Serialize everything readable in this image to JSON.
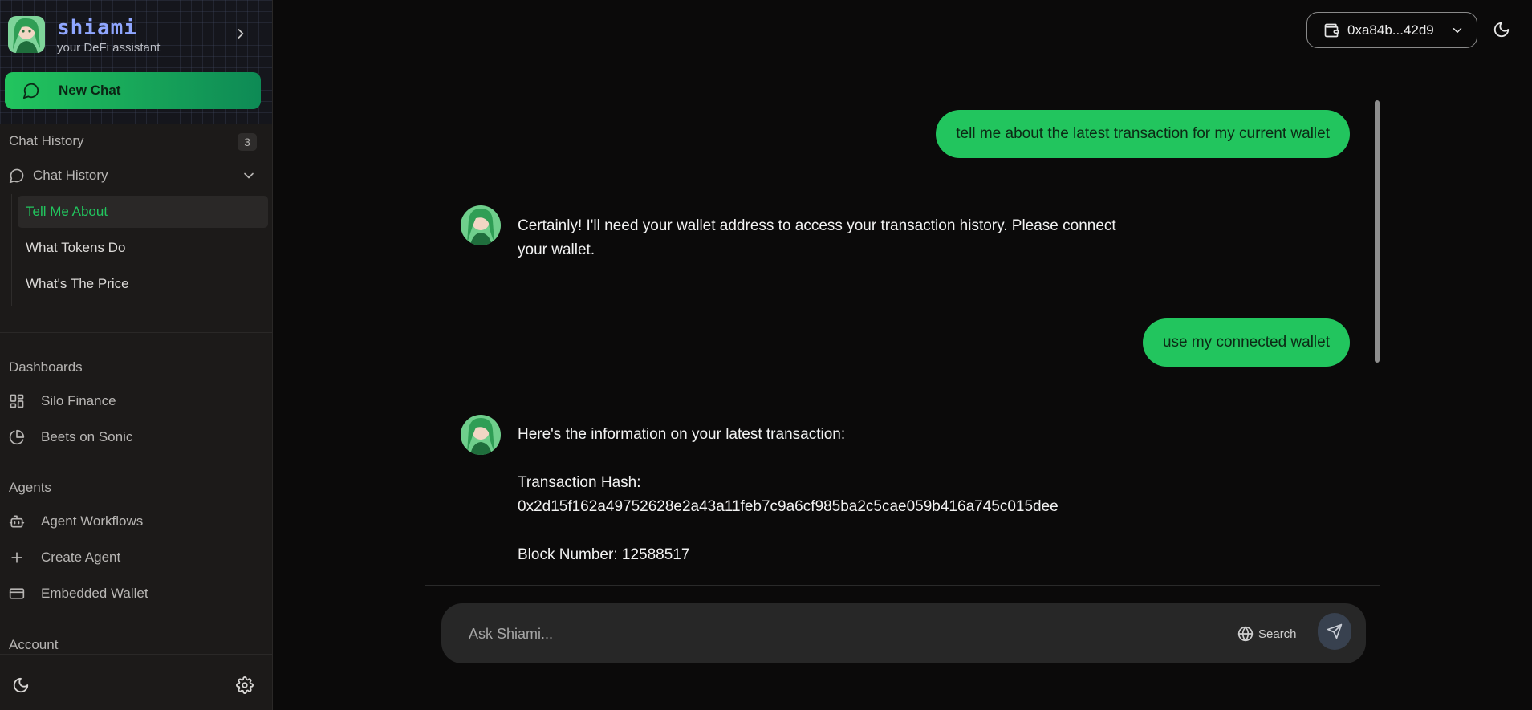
{
  "brand": {
    "name": "shiami",
    "tagline": "your DeFi assistant"
  },
  "sidebar": {
    "new_chat_label": "New Chat",
    "chat_history": {
      "title": "Chat History",
      "count": "3",
      "toggle_label": "Chat History",
      "items": [
        {
          "label": "Tell Me About",
          "active": true
        },
        {
          "label": "What Tokens Do",
          "active": false
        },
        {
          "label": "What's The Price",
          "active": false
        }
      ]
    },
    "dashboards": {
      "title": "Dashboards",
      "items": [
        {
          "label": "Silo Finance",
          "icon": "grid-icon"
        },
        {
          "label": "Beets on Sonic",
          "icon": "pie-chart-icon"
        }
      ]
    },
    "agents": {
      "title": "Agents",
      "items": [
        {
          "label": "Agent Workflows",
          "icon": "bot-icon"
        },
        {
          "label": "Create Agent",
          "icon": "plus-icon"
        },
        {
          "label": "Embedded Wallet",
          "icon": "credit-card-icon"
        }
      ]
    },
    "account": {
      "title": "Account"
    }
  },
  "header": {
    "wallet_label": "0xa84b...42d9"
  },
  "chat": {
    "messages": [
      {
        "role": "user",
        "text": "tell me about the latest transaction for my current wallet"
      },
      {
        "role": "assistant",
        "lines": [
          "Certainly!  I'll need your wallet address to access your transaction history.  Please connect",
          "your wallet."
        ]
      },
      {
        "role": "user",
        "text": "use my connected wallet"
      },
      {
        "role": "assistant",
        "lines": [
          "Here's the information on your latest transaction:",
          "",
          "Transaction Hash:",
          "0x2d15f162a49752628e2a43a11feb7c9a6cf985ba2c5cae059b416a745c015dee",
          "",
          "Block Number: 12588517"
        ]
      }
    ]
  },
  "composer": {
    "placeholder": "Ask Shiami...",
    "search_label": "Search"
  },
  "colors": {
    "accent": "#22c55e",
    "background": "#0b0a0a",
    "sidebar": "#1c1a19"
  }
}
